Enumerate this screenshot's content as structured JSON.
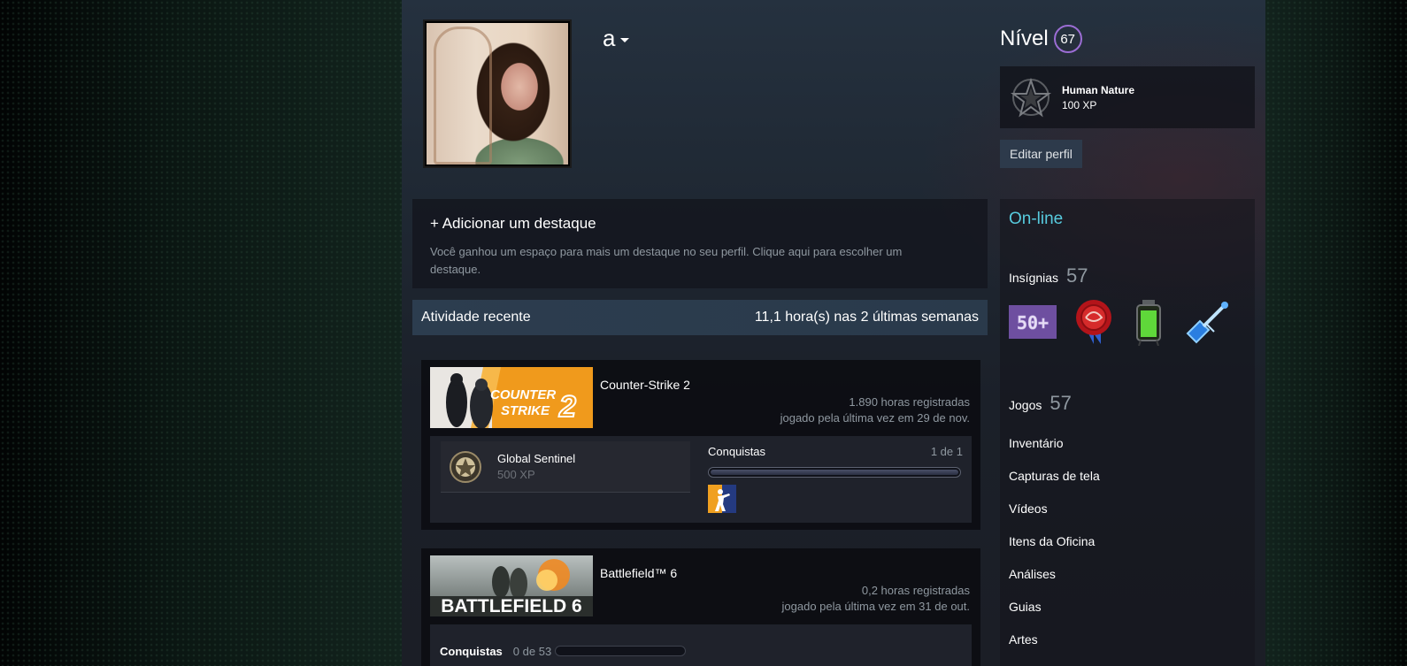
{
  "profile": {
    "persona_name": "a",
    "level_label": "Nível",
    "level": "67",
    "favorite_badge": {
      "name": "Human Nature",
      "xp": "100 XP",
      "icon": "pentagram-icon"
    },
    "edit_button": "Editar perfil"
  },
  "showcase": {
    "title": "+ Adicionar um destaque",
    "description": "Você ganhou um espaço para mais um destaque no seu perfil. Clique aqui para escolher um destaque."
  },
  "recent_activity": {
    "title": "Atividade recente",
    "hours_summary": "11,1 hora(s) nas 2 últimas semanas",
    "games": [
      {
        "name": "Counter-Strike 2",
        "hours": "1.890 horas registradas",
        "last_played": "jogado pela última vez em 29 de nov.",
        "capsule_text": [
          "COUNTER",
          "STRIKE",
          "2"
        ],
        "featured_achievement": {
          "name": "Global Sentinel",
          "xp": "500 XP"
        },
        "achievements_label": "Conquistas",
        "achievements_count": "1 de 1",
        "achievements_progress": 1.0
      },
      {
        "name": "Battlefield™ 6",
        "hours": "0,2 horas registradas",
        "last_played": "jogado pela última vez em 31 de out.",
        "capsule_text": "BATTLEFIELD 6",
        "achievements_label": "Conquistas",
        "achievements_count": "0 de 53",
        "achievements_progress": 0.0
      }
    ]
  },
  "sidebar": {
    "status": "On-line",
    "badges_label": "Insígnias",
    "badges_count": "57",
    "badge_icons": [
      "50-plus-badge-icon",
      "wax-seal-badge-icon",
      "green-battery-badge-icon",
      "blue-guitar-badge-icon"
    ],
    "badge_50_text": "50+",
    "games_label": "Jogos",
    "games_count": "57",
    "links": [
      "Inventário",
      "Capturas de tela",
      "Vídeos",
      "Itens da Oficina",
      "Análises",
      "Guias",
      "Artes"
    ]
  },
  "colors": {
    "accent_online": "#57cbde",
    "level_ring": "#9b6dd4",
    "cs_orange": "#f09a1c"
  }
}
